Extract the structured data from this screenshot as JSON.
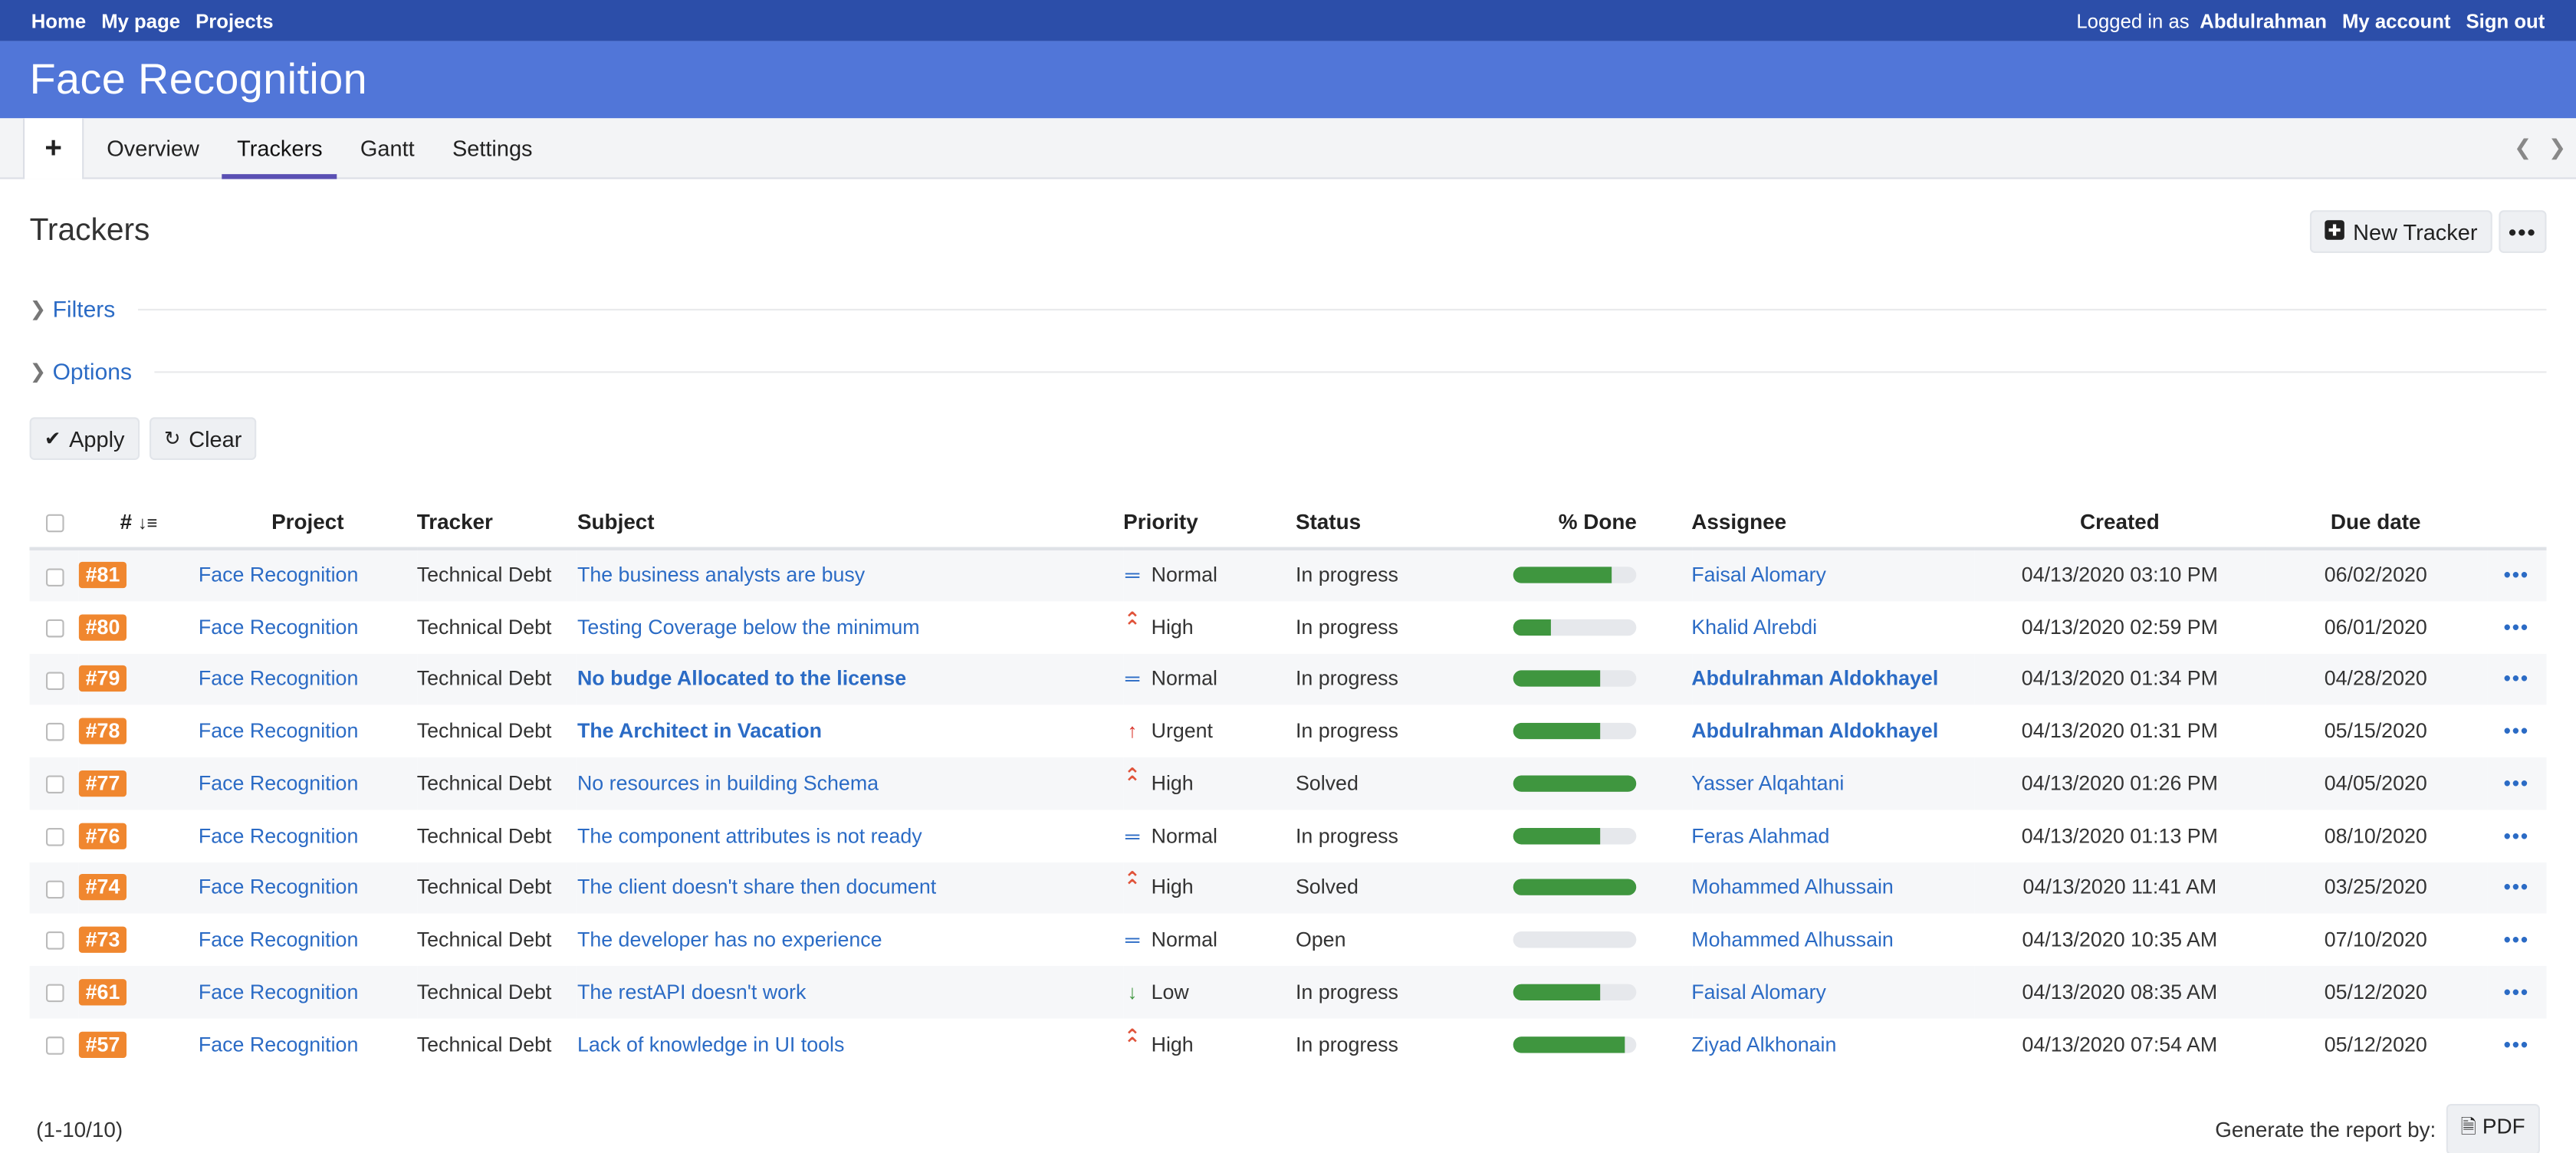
{
  "topbar": {
    "home": "Home",
    "my_page": "My page",
    "projects": "Projects",
    "logged_in_as": "Logged in as",
    "user": "Abdulrahman",
    "my_account": "My account",
    "sign_out": "Sign out"
  },
  "header": {
    "title": "Face Recognition"
  },
  "tabs": {
    "plus": "+",
    "items": [
      "Overview",
      "Trackers",
      "Gantt",
      "Settings"
    ],
    "active": "Trackers"
  },
  "page": {
    "title": "Trackers",
    "new_tracker": "New Tracker",
    "filters": "Filters",
    "options": "Options",
    "apply": "Apply",
    "clear": "Clear"
  },
  "table": {
    "headers": {
      "id": "#",
      "project": "Project",
      "tracker": "Tracker",
      "subject": "Subject",
      "priority": "Priority",
      "status": "Status",
      "done": "% Done",
      "assignee": "Assignee",
      "created": "Created",
      "due": "Due date"
    },
    "rows": [
      {
        "id": "#81",
        "project": "Face Recognition",
        "tracker": "Technical Debt",
        "subject": "The business analysts are busy",
        "subject_bold": false,
        "priority": "Normal",
        "priority_icon": "equals-icon",
        "status": "In progress",
        "done": 80,
        "assignee": "Faisal Alomary",
        "assignee_bold": false,
        "created": "04/13/2020 03:10 PM",
        "due": "06/02/2020"
      },
      {
        "id": "#80",
        "project": "Face Recognition",
        "tracker": "Technical Debt",
        "subject": "Testing Coverage below the minimum",
        "subject_bold": false,
        "priority": "High",
        "priority_icon": "double-chevron-up-icon",
        "status": "In progress",
        "done": 30,
        "assignee": "Khalid Alrebdi",
        "assignee_bold": false,
        "created": "04/13/2020 02:59 PM",
        "due": "06/01/2020"
      },
      {
        "id": "#79",
        "project": "Face Recognition",
        "tracker": "Technical Debt",
        "subject": "No budge Allocated to the license",
        "subject_bold": true,
        "priority": "Normal",
        "priority_icon": "equals-icon",
        "status": "In progress",
        "done": 70,
        "assignee": "Abdulrahman Aldokhayel",
        "assignee_bold": true,
        "created": "04/13/2020 01:34 PM",
        "due": "04/28/2020"
      },
      {
        "id": "#78",
        "project": "Face Recognition",
        "tracker": "Technical Debt",
        "subject": "The Architect in Vacation",
        "subject_bold": true,
        "priority": "Urgent",
        "priority_icon": "arrow-up-icon",
        "status": "In progress",
        "done": 70,
        "assignee": "Abdulrahman Aldokhayel",
        "assignee_bold": true,
        "created": "04/13/2020 01:31 PM",
        "due": "05/15/2020"
      },
      {
        "id": "#77",
        "project": "Face Recognition",
        "tracker": "Technical Debt",
        "subject": "No resources in building Schema",
        "subject_bold": false,
        "priority": "High",
        "priority_icon": "double-chevron-up-icon",
        "status": "Solved",
        "done": 100,
        "assignee": "Yasser Alqahtani",
        "assignee_bold": false,
        "created": "04/13/2020 01:26 PM",
        "due": "04/05/2020"
      },
      {
        "id": "#76",
        "project": "Face Recognition",
        "tracker": "Technical Debt",
        "subject": "The component attributes is not ready",
        "subject_bold": false,
        "priority": "Normal",
        "priority_icon": "equals-icon",
        "status": "In progress",
        "done": 70,
        "assignee": "Feras Alahmad",
        "assignee_bold": false,
        "created": "04/13/2020 01:13 PM",
        "due": "08/10/2020"
      },
      {
        "id": "#74",
        "project": "Face Recognition",
        "tracker": "Technical Debt",
        "subject": "The client doesn't share then document",
        "subject_bold": false,
        "priority": "High",
        "priority_icon": "double-chevron-up-icon",
        "status": "Solved",
        "done": 100,
        "assignee": "Mohammed Alhussain",
        "assignee_bold": false,
        "created": "04/13/2020 11:41 AM",
        "due": "03/25/2020"
      },
      {
        "id": "#73",
        "project": "Face Recognition",
        "tracker": "Technical Debt",
        "subject": "The developer has no experience",
        "subject_bold": false,
        "priority": "Normal",
        "priority_icon": "equals-icon",
        "status": "Open",
        "done": 0,
        "assignee": "Mohammed Alhussain",
        "assignee_bold": false,
        "created": "04/13/2020 10:35 AM",
        "due": "07/10/2020"
      },
      {
        "id": "#61",
        "project": "Face Recognition",
        "tracker": "Technical Debt",
        "subject": "The restAPI doesn't work",
        "subject_bold": false,
        "priority": "Low",
        "priority_icon": "arrow-down-icon",
        "status": "In progress",
        "done": 70,
        "assignee": "Faisal Alomary",
        "assignee_bold": false,
        "created": "04/13/2020 08:35 AM",
        "due": "05/12/2020"
      },
      {
        "id": "#57",
        "project": "Face Recognition",
        "tracker": "Technical Debt",
        "subject": "Lack of knowledge in UI tools",
        "subject_bold": false,
        "priority": "High",
        "priority_icon": "double-chevron-up-icon",
        "status": "In progress",
        "done": 90,
        "assignee": "Ziyad Alkhonain",
        "assignee_bold": false,
        "created": "04/13/2020 07:54 AM",
        "due": "05/12/2020"
      }
    ]
  },
  "footer": {
    "count": "(1-10/10)",
    "generate": "Generate the report by:",
    "pdf": "PDF"
  },
  "colors": {
    "topbar": "#2c4ea9",
    "header": "#5176d8",
    "id_badge": "#f0872f",
    "link": "#2b6bc5",
    "progress": "#3f963f",
    "priority_high": "#e0533a",
    "priority_normal": "#2b6bc5",
    "priority_urgent": "#d9342b",
    "priority_low": "#3f963f"
  }
}
